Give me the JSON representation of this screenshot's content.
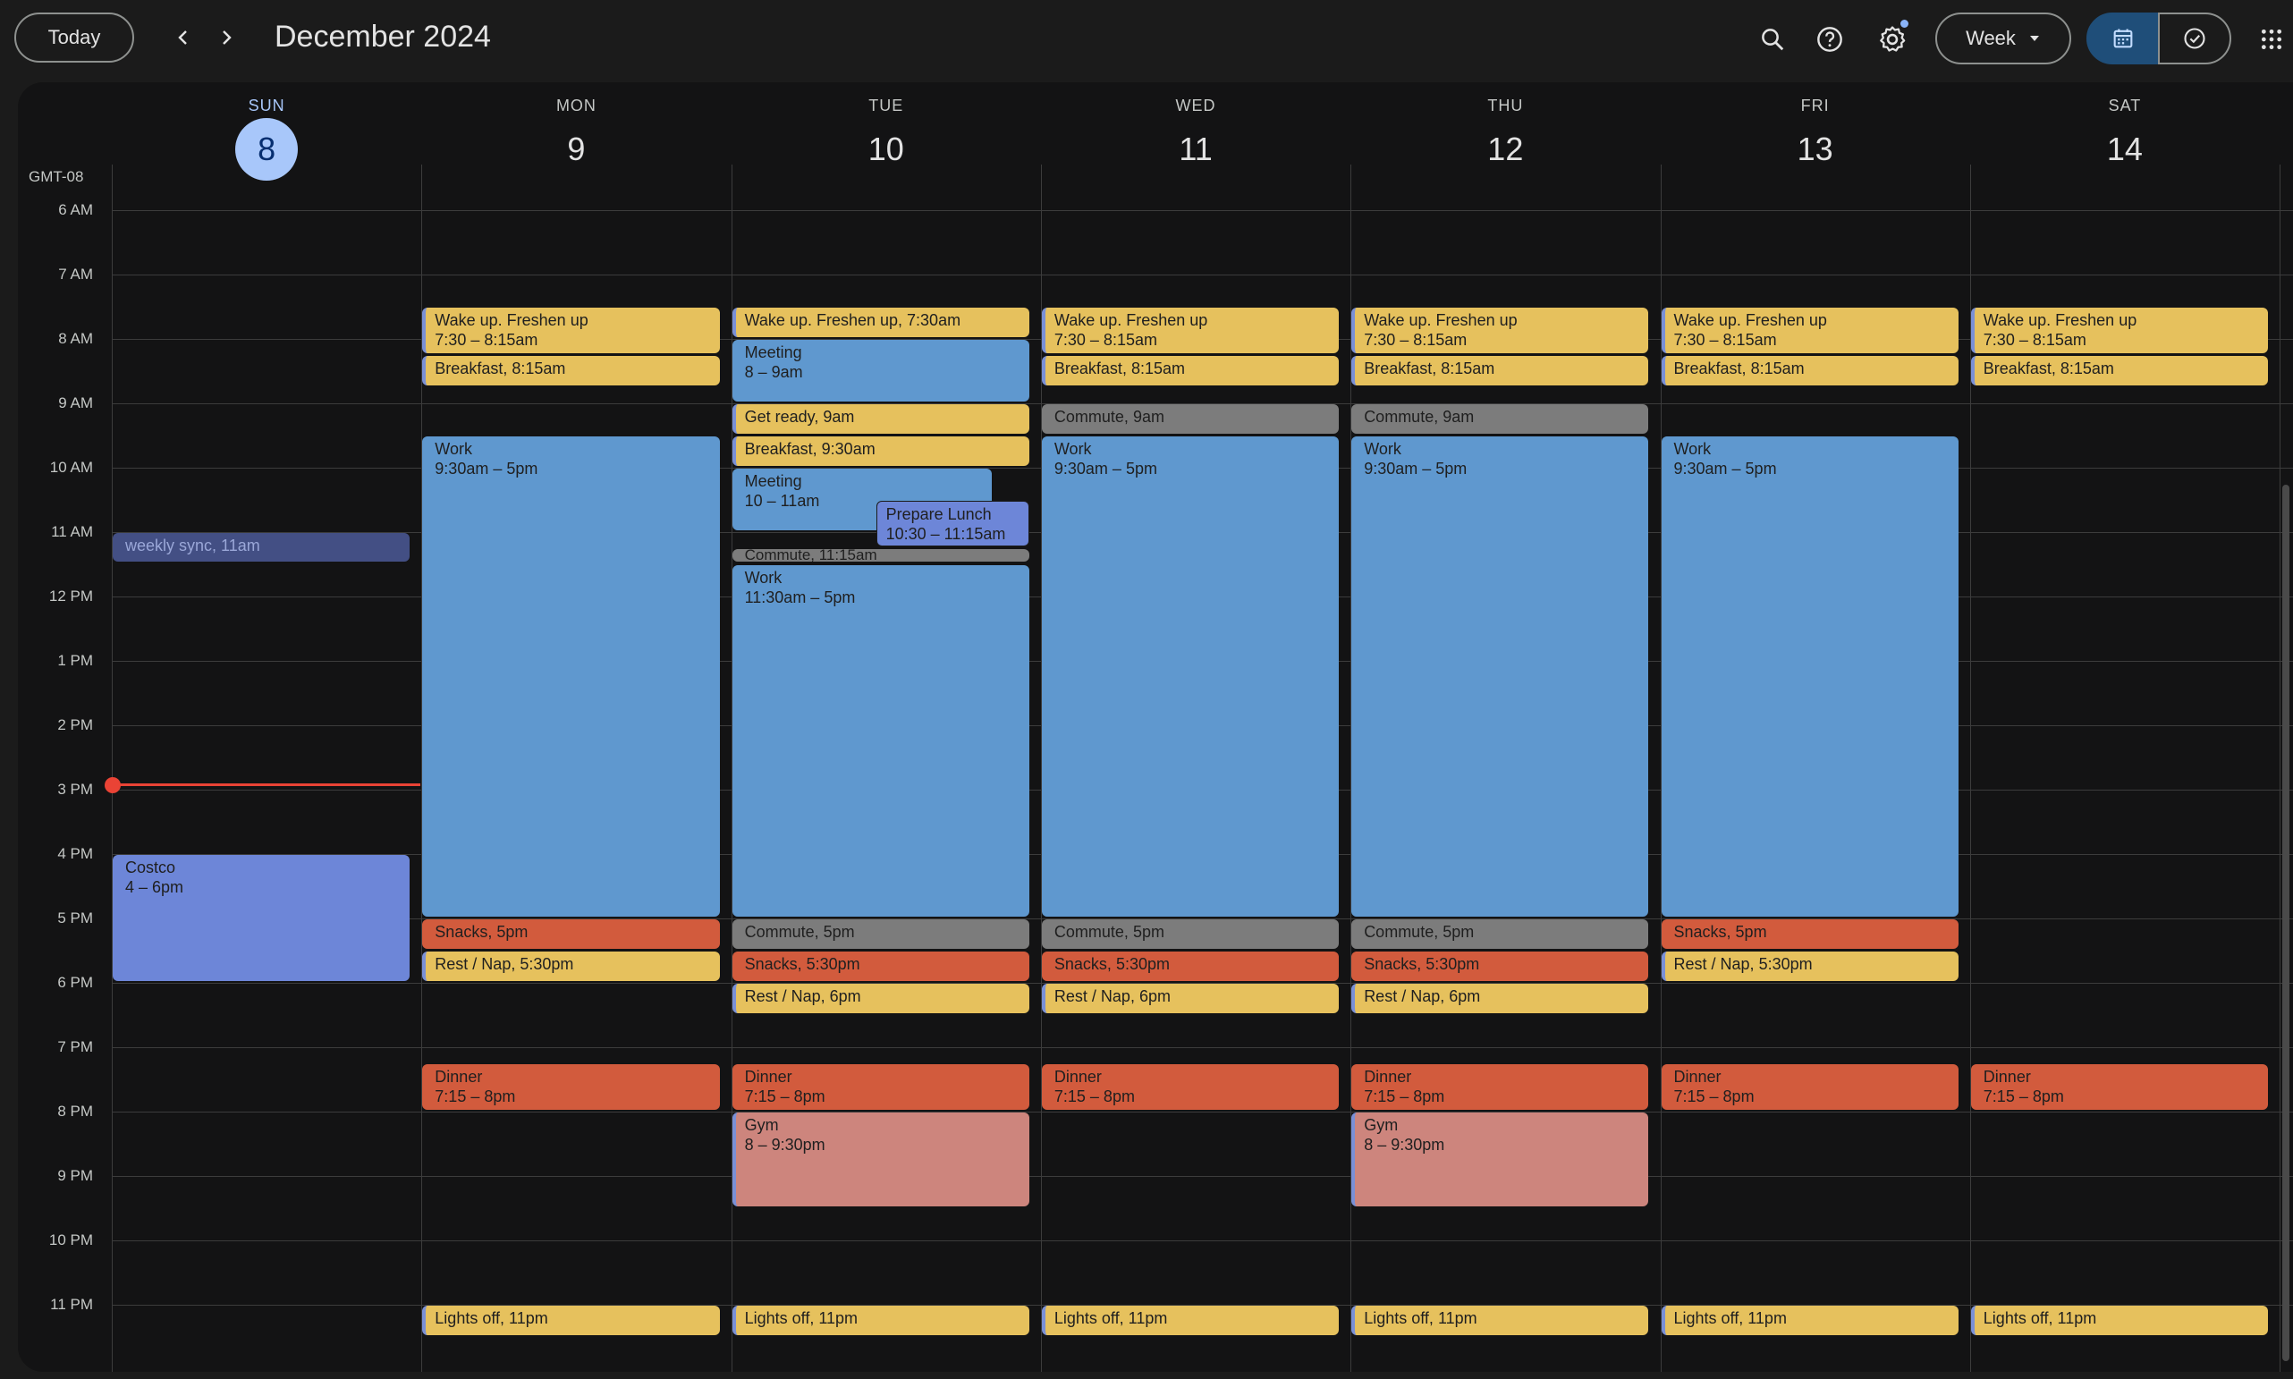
{
  "header": {
    "today_label": "Today",
    "month_title": "December 2024",
    "view_label": "Week"
  },
  "icons": {
    "prev": "chevron-left-icon",
    "next": "chevron-right-icon",
    "search": "search-icon",
    "help": "help-icon",
    "settings": "gear-icon",
    "view_dropdown": "caret-down-icon",
    "calendar": "calendar-icon",
    "tasks": "check-circle-icon",
    "apps": "apps-grid-icon"
  },
  "timezone": "GMT-08",
  "days": [
    {
      "dow": "SUN",
      "num": "8",
      "today": true
    },
    {
      "dow": "MON",
      "num": "9"
    },
    {
      "dow": "TUE",
      "num": "10"
    },
    {
      "dow": "WED",
      "num": "11"
    },
    {
      "dow": "THU",
      "num": "12"
    },
    {
      "dow": "FRI",
      "num": "13"
    },
    {
      "dow": "SAT",
      "num": "14"
    }
  ],
  "hours": [
    "6 AM",
    "7 AM",
    "8 AM",
    "9 AM",
    "10 AM",
    "11 AM",
    "12 PM",
    "1 PM",
    "2 PM",
    "3 PM",
    "4 PM",
    "5 PM",
    "6 PM",
    "7 PM",
    "8 PM",
    "9 PM",
    "10 PM",
    "11 PM"
  ],
  "colors": {
    "yellow": "#e6c15d",
    "blue": "#5f98cf",
    "gray": "#7c7c7c",
    "red": "#d25b3d",
    "pink": "#cd857d",
    "lavender": "#6d86d8",
    "now_line": "#ea4335",
    "today_accent": "#a8c7fa"
  },
  "now_time": "2:55 PM",
  "events": [
    {
      "day": 0,
      "title": "weekly sync",
      "time": "11am",
      "color": "sync",
      "inline": true
    },
    {
      "day": 0,
      "title": "Costco",
      "time": "4 – 6pm",
      "color": "lavender"
    },
    {
      "day": 1,
      "title": "Wake up. Freshen up",
      "time": "7:30 – 8:15am",
      "color": "yellow"
    },
    {
      "day": 1,
      "title": "Breakfast",
      "time": "8:15am",
      "color": "yellow",
      "inline": true
    },
    {
      "day": 1,
      "title": "Work",
      "time": "9:30am – 5pm",
      "color": "blue"
    },
    {
      "day": 1,
      "title": "Snacks",
      "time": "5pm",
      "color": "red",
      "inline": true
    },
    {
      "day": 1,
      "title": "Rest / Nap",
      "time": "5:30pm",
      "color": "yellow",
      "inline": true
    },
    {
      "day": 1,
      "title": "Dinner",
      "time": "7:15 – 8pm",
      "color": "red"
    },
    {
      "day": 1,
      "title": "Lights off",
      "time": "11pm",
      "color": "yellow",
      "inline": true
    },
    {
      "day": 2,
      "title": "Wake up. Freshen up",
      "time": "7:30am",
      "color": "yellow",
      "inline": true
    },
    {
      "day": 2,
      "title": "Meeting",
      "time": "8 – 9am",
      "color": "blue"
    },
    {
      "day": 2,
      "title": "Get ready",
      "time": "9am",
      "color": "yellow",
      "inline": true
    },
    {
      "day": 2,
      "title": "Breakfast",
      "time": "9:30am",
      "color": "yellow",
      "inline": true
    },
    {
      "day": 2,
      "title": "Meeting",
      "time": "10 – 11am",
      "color": "blue"
    },
    {
      "day": 2,
      "title": "Prepare Lunch",
      "time": "10:30 – 11:15am",
      "color": "lavender"
    },
    {
      "day": 2,
      "title": "Commute",
      "time": "11:15am",
      "color": "gray",
      "inline": true
    },
    {
      "day": 2,
      "title": "Work",
      "time": "11:30am – 5pm",
      "color": "blue"
    },
    {
      "day": 2,
      "title": "Commute",
      "time": "5pm",
      "color": "gray",
      "inline": true
    },
    {
      "day": 2,
      "title": "Snacks",
      "time": "5:30pm",
      "color": "red",
      "inline": true
    },
    {
      "day": 2,
      "title": "Rest / Nap",
      "time": "6pm",
      "color": "yellow",
      "inline": true
    },
    {
      "day": 2,
      "title": "Dinner",
      "time": "7:15 – 8pm",
      "color": "red"
    },
    {
      "day": 2,
      "title": "Gym",
      "time": "8 – 9:30pm",
      "color": "pink"
    },
    {
      "day": 2,
      "title": "Lights off",
      "time": "11pm",
      "color": "yellow",
      "inline": true
    },
    {
      "day": 3,
      "title": "Wake up. Freshen up",
      "time": "7:30 – 8:15am",
      "color": "yellow"
    },
    {
      "day": 3,
      "title": "Breakfast",
      "time": "8:15am",
      "color": "yellow",
      "inline": true
    },
    {
      "day": 3,
      "title": "Commute",
      "time": "9am",
      "color": "gray",
      "inline": true
    },
    {
      "day": 3,
      "title": "Work",
      "time": "9:30am – 5pm",
      "color": "blue"
    },
    {
      "day": 3,
      "title": "Commute",
      "time": "5pm",
      "color": "gray",
      "inline": true
    },
    {
      "day": 3,
      "title": "Snacks",
      "time": "5:30pm",
      "color": "red",
      "inline": true
    },
    {
      "day": 3,
      "title": "Rest / Nap",
      "time": "6pm",
      "color": "yellow",
      "inline": true
    },
    {
      "day": 3,
      "title": "Dinner",
      "time": "7:15 – 8pm",
      "color": "red"
    },
    {
      "day": 3,
      "title": "Lights off",
      "time": "11pm",
      "color": "yellow",
      "inline": true
    },
    {
      "day": 4,
      "title": "Wake up. Freshen up",
      "time": "7:30 – 8:15am",
      "color": "yellow"
    },
    {
      "day": 4,
      "title": "Breakfast",
      "time": "8:15am",
      "color": "yellow",
      "inline": true
    },
    {
      "day": 4,
      "title": "Commute",
      "time": "9am",
      "color": "gray",
      "inline": true
    },
    {
      "day": 4,
      "title": "Work",
      "time": "9:30am – 5pm",
      "color": "blue"
    },
    {
      "day": 4,
      "title": "Commute",
      "time": "5pm",
      "color": "gray",
      "inline": true
    },
    {
      "day": 4,
      "title": "Snacks",
      "time": "5:30pm",
      "color": "red",
      "inline": true
    },
    {
      "day": 4,
      "title": "Rest / Nap",
      "time": "6pm",
      "color": "yellow",
      "inline": true
    },
    {
      "day": 4,
      "title": "Dinner",
      "time": "7:15 – 8pm",
      "color": "red"
    },
    {
      "day": 4,
      "title": "Gym",
      "time": "8 – 9:30pm",
      "color": "pink"
    },
    {
      "day": 4,
      "title": "Lights off",
      "time": "11pm",
      "color": "yellow",
      "inline": true
    },
    {
      "day": 5,
      "title": "Wake up. Freshen up",
      "time": "7:30 – 8:15am",
      "color": "yellow"
    },
    {
      "day": 5,
      "title": "Breakfast",
      "time": "8:15am",
      "color": "yellow",
      "inline": true
    },
    {
      "day": 5,
      "title": "Work",
      "time": "9:30am – 5pm",
      "color": "blue"
    },
    {
      "day": 5,
      "title": "Snacks",
      "time": "5pm",
      "color": "red",
      "inline": true
    },
    {
      "day": 5,
      "title": "Rest / Nap",
      "time": "5:30pm",
      "color": "yellow",
      "inline": true
    },
    {
      "day": 5,
      "title": "Dinner",
      "time": "7:15 – 8pm",
      "color": "red"
    },
    {
      "day": 5,
      "title": "Lights off",
      "time": "11pm",
      "color": "yellow",
      "inline": true
    },
    {
      "day": 6,
      "title": "Wake up. Freshen up",
      "time": "7:30 – 8:15am",
      "color": "yellow"
    },
    {
      "day": 6,
      "title": "Breakfast",
      "time": "8:15am",
      "color": "yellow",
      "inline": true
    },
    {
      "day": 6,
      "title": "Dinner",
      "time": "7:15 – 8pm",
      "color": "red"
    },
    {
      "day": 6,
      "title": "Lights off",
      "time": "11pm",
      "color": "yellow",
      "inline": true
    }
  ]
}
